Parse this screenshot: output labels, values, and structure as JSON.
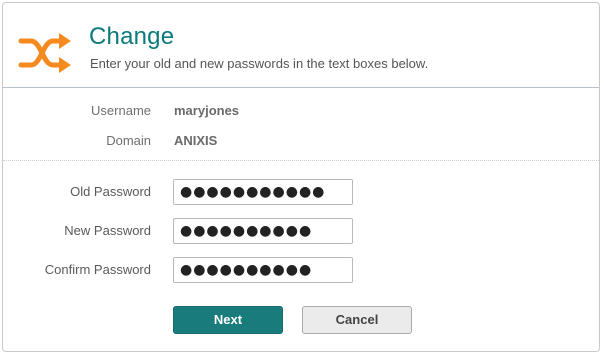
{
  "header": {
    "title": "Change",
    "subtitle": "Enter your old and new passwords in the text boxes below.",
    "icon": "shuffle-icon",
    "accent_color": "#f58a1f"
  },
  "account": {
    "username_label": "Username",
    "username_value": "maryjones",
    "domain_label": "Domain",
    "domain_value": "ANIXIS"
  },
  "form": {
    "old_password_label": "Old Password",
    "old_password_value": "●●●●●●●●●●●",
    "new_password_label": "New Password",
    "new_password_value": "●●●●●●●●●●",
    "confirm_password_label": "Confirm Password",
    "confirm_password_value": "●●●●●●●●●●"
  },
  "buttons": {
    "next_label": "Next",
    "cancel_label": "Cancel",
    "primary_color": "#1a7b7c"
  }
}
